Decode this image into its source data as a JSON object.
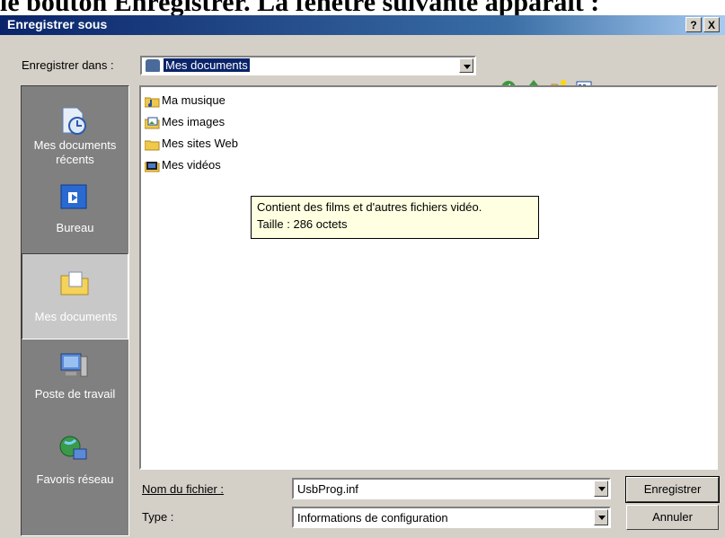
{
  "document": {
    "heading_text": "le bouton Enregistrer. La fenêtre suivante apparaît :"
  },
  "window": {
    "title": "Enregistrer sous",
    "help_button": "?",
    "close_button": "X"
  },
  "save_in": {
    "label": "Enregistrer dans :",
    "value": "Mes documents"
  },
  "places": [
    {
      "label_line1": "Mes documents",
      "label_line2": "récents"
    },
    {
      "label_line1": "Bureau",
      "label_line2": ""
    },
    {
      "label_line1": "Mes documents",
      "label_line2": ""
    },
    {
      "label_line1": "Poste de travail",
      "label_line2": ""
    },
    {
      "label_line1": "Favoris réseau",
      "label_line2": ""
    }
  ],
  "files": [
    {
      "name": "Ma musique",
      "icon": "music-folder-icon"
    },
    {
      "name": "Mes images",
      "icon": "pictures-folder-icon"
    },
    {
      "name": "Mes sites Web",
      "icon": "folder-icon"
    },
    {
      "name": "Mes vidéos",
      "icon": "videos-folder-icon"
    }
  ],
  "tooltip": {
    "line1": "Contient des films et d'autres fichiers vidéo.",
    "line2": "Taille : 286 octets"
  },
  "filename": {
    "label": "Nom du fichier :",
    "value": "UsbProg.inf"
  },
  "filetype": {
    "label": "Type :",
    "value": "Informations de configuration"
  },
  "buttons": {
    "save": "Enregistrer",
    "cancel": "Annuler"
  },
  "colors": {
    "titlebar": "#0a246a",
    "tooltip_bg": "#ffffe1",
    "places_bg": "#808080",
    "dialog_bg": "#d4d0c8"
  }
}
